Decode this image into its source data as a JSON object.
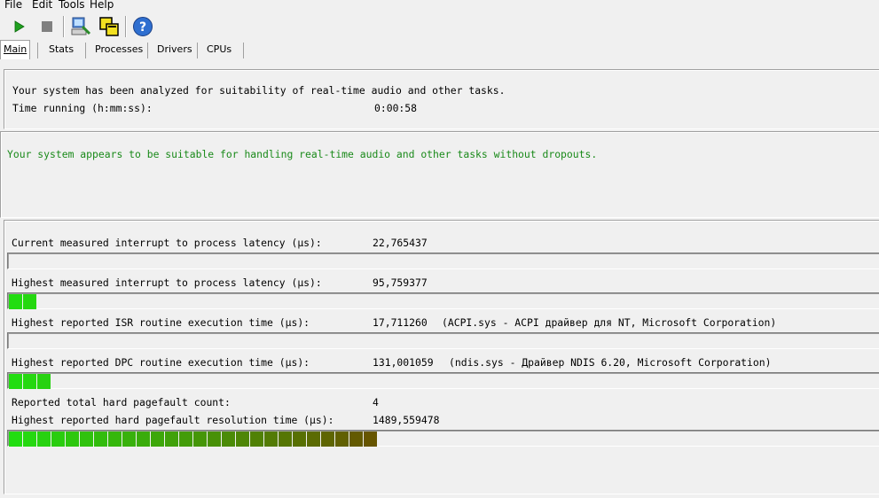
{
  "menu": {
    "file": "File",
    "edit": "Edit",
    "tools": "Tools",
    "help": "Help"
  },
  "toolbar": {
    "icons": [
      "play-icon",
      "stop-icon",
      "computer-icon",
      "windows-icon",
      "help-icon"
    ]
  },
  "tabs": [
    "Main",
    "Stats",
    "Processes",
    "Drivers",
    "CPUs"
  ],
  "summary": {
    "line1": "Your system has been analyzed for suitability of real-time audio and other tasks.",
    "time_label": "Time running (h:mm:ss):",
    "time_value": "0:00:58"
  },
  "verdict": {
    "text": "Your system appears to be suitable for handling real-time audio and other tasks without dropouts.",
    "color": "#1a8a1a"
  },
  "metrics": [
    {
      "label": "Current measured interrupt to process latency (µs):",
      "value": "22,765437",
      "detail": "",
      "bar_segments": 0
    },
    {
      "label": "Highest measured interrupt to process latency (µs):",
      "value": "95,759377",
      "detail": "",
      "bar_segments": 2
    },
    {
      "label": "Highest reported ISR routine execution time (µs):",
      "value": "17,711260",
      "detail": "(ACPI.sys - ACPI драйвер для NT, Microsoft Corporation)",
      "bar_segments": 0
    },
    {
      "label": "Highest reported DPC routine execution time (µs):",
      "value": "131,001059",
      "detail": "(ndis.sys - Драйвер NDIS 6.20, Microsoft Corporation)",
      "bar_segments": 3
    }
  ],
  "pagefault": {
    "count_label": "Reported total hard pagefault count:",
    "count_value": "4",
    "time_label": "Highest reported hard pagefault resolution time (µs):",
    "time_value": "1489,559478",
    "bar_segments": 26
  }
}
